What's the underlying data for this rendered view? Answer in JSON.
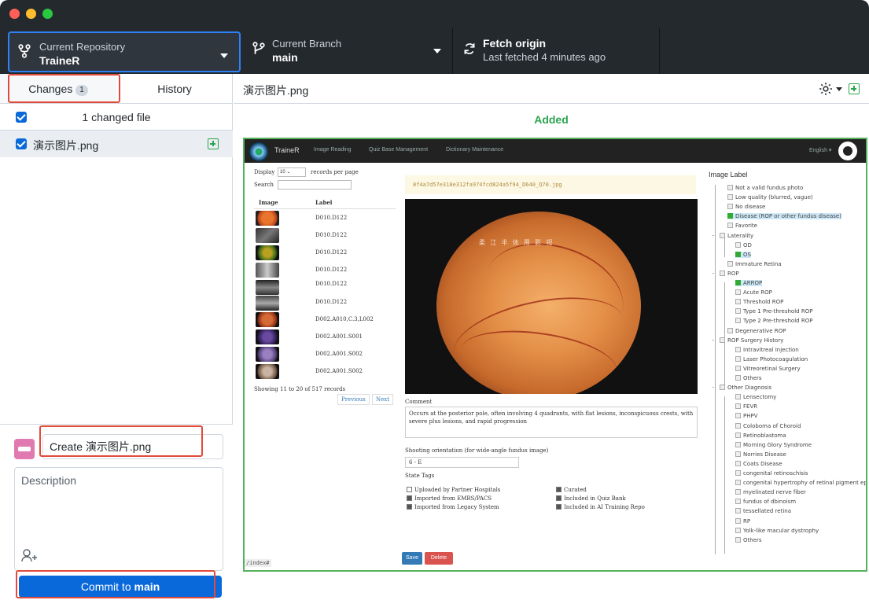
{
  "toolbar": {
    "repo_label": "Current Repository",
    "repo_value": "TraineR",
    "branch_label": "Current Branch",
    "branch_value": "main",
    "fetch_label": "Fetch origin",
    "fetch_value": "Last fetched 4 minutes ago"
  },
  "sidebar": {
    "tab_changes": "Changes",
    "changes_count": "1",
    "tab_history": "History",
    "changed_files": "1 changed file",
    "file_name": "演示图片.png",
    "summary_value": "Create 演示图片.png",
    "description_placeholder": "Description",
    "commit_prefix": "Commit to",
    "commit_branch": "main"
  },
  "main": {
    "file_title": "演示图片.png",
    "status": "Added"
  },
  "preview": {
    "brand": "TraineR",
    "menu": [
      "Image Reading",
      "Quiz Base Management",
      "Dictionary Maintenance"
    ],
    "lang": "English ▾",
    "display_label": "Display",
    "display_value": "10",
    "records_label": "records per page",
    "search_label": "Search",
    "col_image": "Image",
    "col_label": "Label",
    "rows": [
      "D010.D122",
      "D010.D122",
      "D010.D122",
      "D010.D122",
      "D010.D122",
      "D010.D122",
      "D002.A010,C.3,L002",
      "D002.A001.S001",
      "D002.A001.S002",
      "D002.A001.S002"
    ],
    "showing": "Showing 11 to 20 of 517 records",
    "prev": "Previous",
    "next": "Next",
    "image_file": "8f4a7d57e318e312fa974fcd824a5f94_D640_Q70.jpg",
    "watermark": "柔 江 半 体 用 影 视",
    "comment_label": "Comment",
    "comment_text": "Occurs at the posterior pole, often involving 4 quadrants, with flat lesions, inconspicuous crests, with severe plus lesions, and rapid progression",
    "orientation_label": "Shooting orientation (for wide-angle fundus image)",
    "orientation_value": "6 - E",
    "state_tags_label": "State Tags",
    "tags": [
      {
        "label": "Uploaded by Partner Hospitals",
        "checked": false
      },
      {
        "label": "Curated",
        "checked": true
      },
      {
        "label": "Imported from EMRS/PACS",
        "checked": true
      },
      {
        "label": "Included in Quiz Bank",
        "checked": true
      },
      {
        "label": "Imported from Legacy System",
        "checked": true
      },
      {
        "label": "Included in AI Training Repo",
        "checked": true
      }
    ],
    "save": "Save",
    "delete": "Delete",
    "index": "/index#",
    "tree_title": "Image Label",
    "tree": [
      "Not a valid fundus photo",
      "Low quality (blurred, vague)",
      "No disease",
      "Disease (ROP or other fundus disease)",
      "Favorite",
      "Laterality",
      "OD",
      "OS",
      "Immature Retina",
      "ROP",
      "ARROP",
      "Acute ROP",
      "Threshold ROP",
      "Type 1 Pre-threshold ROP",
      "Type 2 Pre-threshold ROP",
      "Degenerative ROP",
      "ROP Surgery History",
      "Intravitreal Injection",
      "Laser Photocoagulation",
      "Vitreoretinal Surgery",
      "Others",
      "Other Diagnosis",
      "Lensectomy",
      "FEVR",
      "PHPV",
      "Coloboma of Choroid",
      "Retinoblastoma",
      "Morning Glory Syndrome",
      "Norries Disease",
      "Coats Disease",
      "congenital retinoschisis",
      "congenital hypertrophy of retinal pigment epit",
      "myelinated nerve fiber",
      "fundus of dbinoism",
      "tessellated retina",
      "RP",
      "Yolk-like macular dystrophy",
      "Others"
    ]
  }
}
